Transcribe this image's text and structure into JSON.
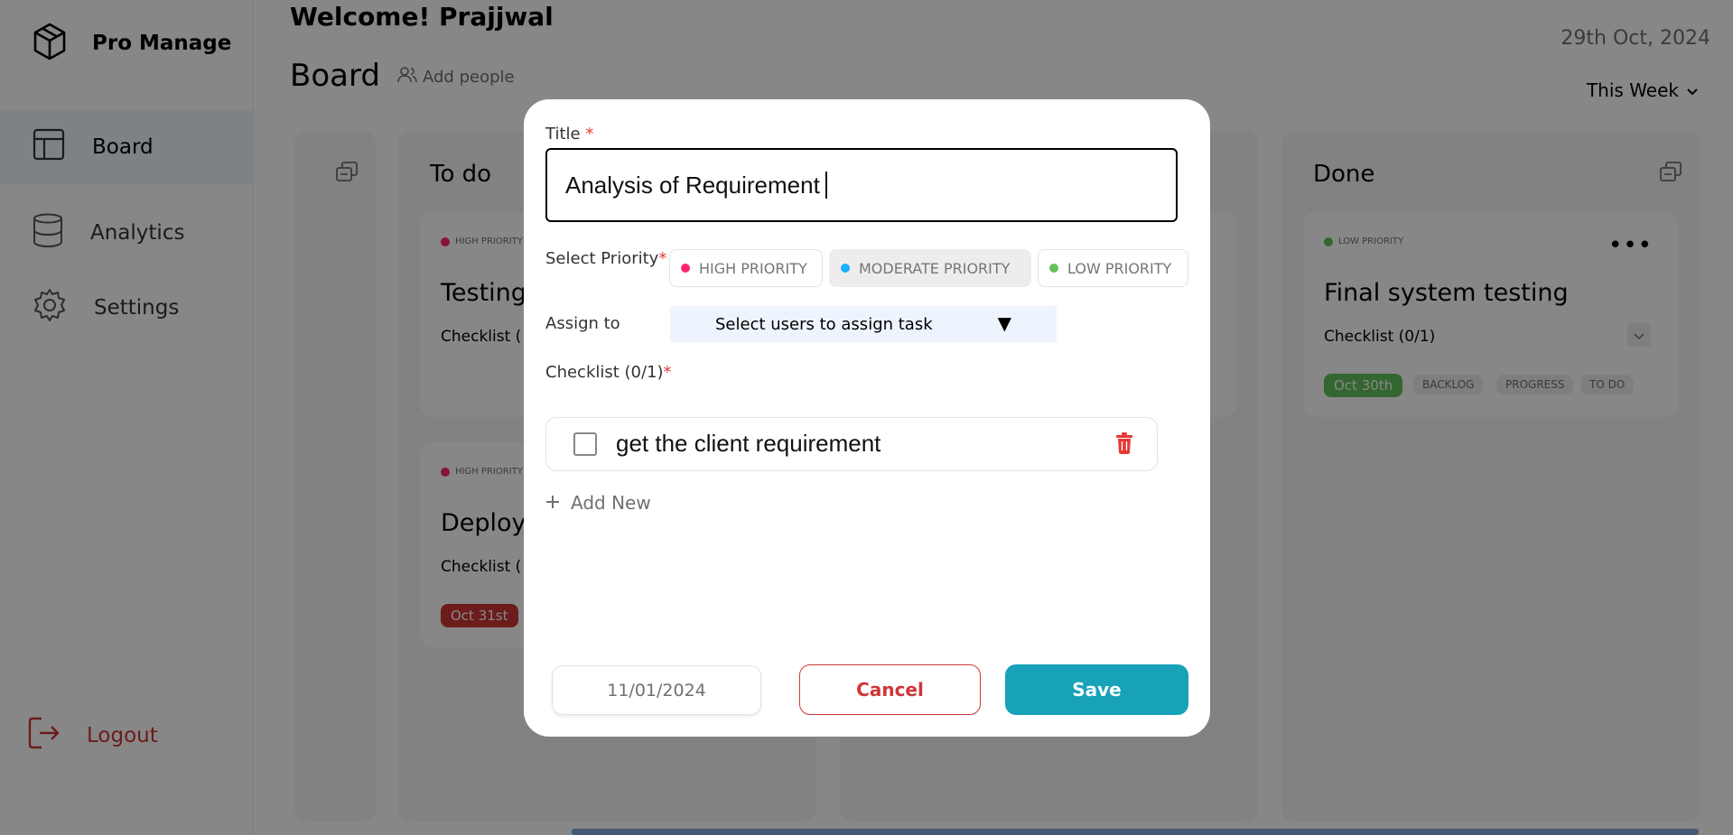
{
  "app": {
    "name": "Pro Manage"
  },
  "sidebar": {
    "items": [
      {
        "label": "Board"
      },
      {
        "label": "Analytics"
      },
      {
        "label": "Settings"
      }
    ],
    "logout_label": "Logout"
  },
  "header": {
    "welcome": "Welcome!  Prajjwal",
    "date": "29th Oct, 2024",
    "board_title": "Board",
    "add_people": "Add people",
    "period": "This Week"
  },
  "columns": [
    {
      "title": "To do"
    },
    {
      "title": "Done"
    }
  ],
  "cards": {
    "todo_1": {
      "priority": "HIGH PRIORITY",
      "title": "Testing",
      "checklist": "Checklist ("
    },
    "todo_2": {
      "priority": "HIGH PRIORITY",
      "title": "Deploy",
      "checklist": "Checklist (",
      "due": "Oct 31st"
    },
    "done_1": {
      "priority": "LOW PRIORITY",
      "title": "Final system testing",
      "checklist": "Checklist (0/1)",
      "due": "Oct 30th",
      "chips": [
        "BACKLOG",
        "PROGRESS",
        "TO DO"
      ]
    }
  },
  "modal": {
    "title_label": "Title",
    "required_mark": "*",
    "title_value": "Analysis of Requirement",
    "priority_label": "Select Priority",
    "priorities": [
      {
        "label": "HIGH PRIORITY",
        "color": "#ff2473"
      },
      {
        "label": "MODERATE PRIORITY",
        "color": "#18b0ff"
      },
      {
        "label": "LOW PRIORITY",
        "color": "#63c05b"
      }
    ],
    "selected_priority": "MODERATE PRIORITY",
    "assign_label": "Assign to",
    "assign_placeholder": "Select users to assign task",
    "assign_arrow": "▼",
    "checklist_label": "Checklist (0/1)",
    "checklist_items": [
      {
        "text": "get the client requirement",
        "checked": false
      }
    ],
    "add_new": "Add New",
    "due_date": "11/01/2024",
    "cancel": "Cancel",
    "save": "Save"
  },
  "colors": {
    "high": "#ff2473",
    "moderate": "#18b0ff",
    "low": "#63c05b",
    "due_red": "#cf3636",
    "due_green": "#63c05b",
    "save": "#17a2b8"
  },
  "icons": [
    "cube-logo-icon",
    "board-icon",
    "database-icon",
    "gear-icon",
    "logout-icon",
    "people-icon",
    "chevron-down-icon",
    "collapse-icon",
    "trash-icon",
    "plus-icon"
  ]
}
